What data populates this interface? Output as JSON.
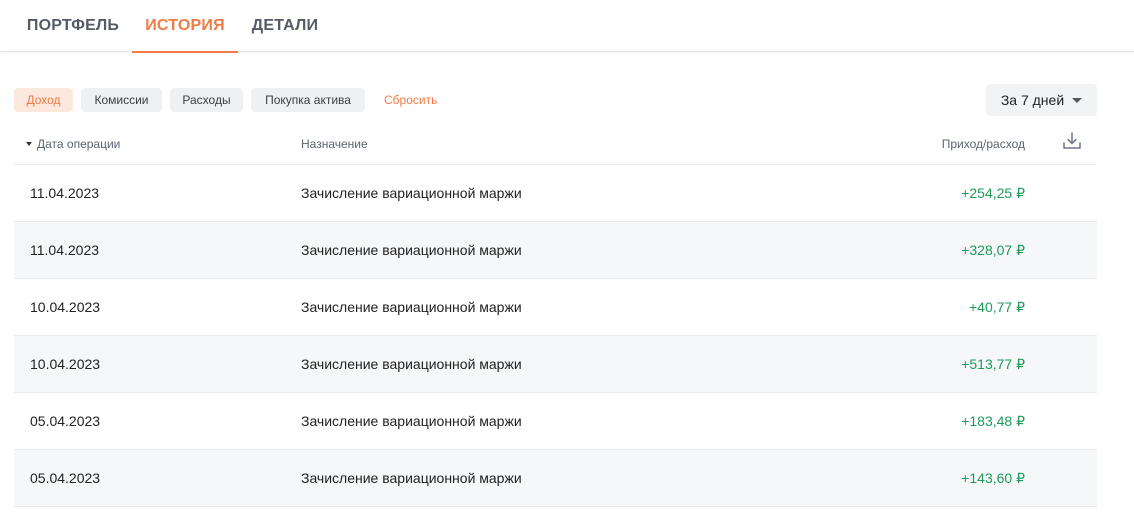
{
  "tabs": [
    {
      "label": "ПОРТФЕЛЬ",
      "active": false
    },
    {
      "label": "ИСТОРИЯ",
      "active": true
    },
    {
      "label": "ДЕТАЛИ",
      "active": false
    }
  ],
  "filters": {
    "chips": [
      {
        "label": "Доход",
        "active": true
      },
      {
        "label": "Комиссии",
        "active": false
      },
      {
        "label": "Расходы",
        "active": false
      },
      {
        "label": "Покупка актива",
        "active": false
      }
    ],
    "reset_label": "Сбросить",
    "period_label": "За 7 дней"
  },
  "table": {
    "columns": {
      "date": "Дата операции",
      "purpose": "Назначение",
      "amount": "Приход/расход"
    },
    "download_icon": "download-icon",
    "rows": [
      {
        "date": "11.04.2023",
        "purpose": "Зачисление вариационной маржи",
        "amount": "+254,25 ₽"
      },
      {
        "date": "11.04.2023",
        "purpose": "Зачисление вариационной маржи",
        "amount": "+328,07 ₽"
      },
      {
        "date": "10.04.2023",
        "purpose": "Зачисление вариационной маржи",
        "amount": "+40,77 ₽"
      },
      {
        "date": "10.04.2023",
        "purpose": "Зачисление вариационной маржи",
        "amount": "+513,77 ₽"
      },
      {
        "date": "05.04.2023",
        "purpose": "Зачисление вариационной маржи",
        "amount": "+183,48 ₽"
      },
      {
        "date": "05.04.2023",
        "purpose": "Зачисление вариационной маржи",
        "amount": "+143,60 ₽"
      }
    ]
  },
  "colors": {
    "accent": "#f07a46",
    "income": "#1f9a5a"
  }
}
